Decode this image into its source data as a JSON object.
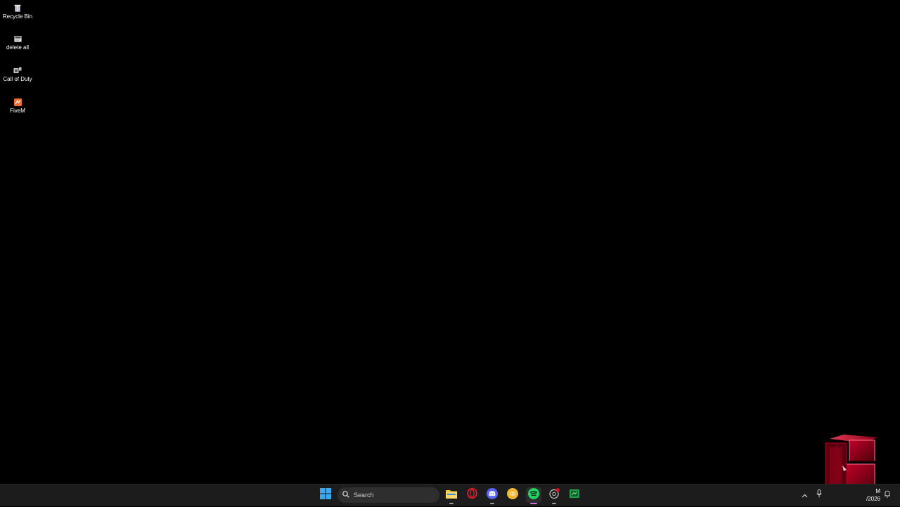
{
  "desktop": {
    "icons": [
      {
        "label": "Recycle Bin",
        "icon": "recycle-bin-icon"
      },
      {
        "label": "delete all",
        "icon": "shortcut-file-icon"
      },
      {
        "label": "Call of Duty",
        "icon": "game-shortcut-icon"
      },
      {
        "label": "FiveM",
        "icon": "fivem-icon"
      }
    ]
  },
  "taskbar": {
    "search": {
      "placeholder": "Search"
    },
    "apps": [
      {
        "name": "start",
        "icon": "windows-logo-icon"
      },
      {
        "name": "file-explorer",
        "icon": "folder-icon"
      },
      {
        "name": "opera",
        "icon": "opera-icon"
      },
      {
        "name": "discord",
        "icon": "discord-icon"
      },
      {
        "name": "app-yellow",
        "icon": "yellow-circle-app-icon"
      },
      {
        "name": "spotify",
        "icon": "spotify-icon",
        "active": true
      },
      {
        "name": "app-notify",
        "icon": "steam-like-icon"
      },
      {
        "name": "app-green",
        "icon": "green-app-icon"
      }
    ],
    "tray": {
      "overflow_icon": "chevron-up-icon",
      "mic_icon": "microphone-icon",
      "clock_time": "M",
      "clock_date": "/2026",
      "notification_icon": "notification-icon"
    }
  },
  "colors": {
    "background": "#000000",
    "taskbar": "#1c1c1c",
    "spotify": "#1ed760",
    "opera": "#ff1b2d",
    "discord": "#5865f2",
    "folder": "#f5c542",
    "widget": "#8b0015"
  }
}
